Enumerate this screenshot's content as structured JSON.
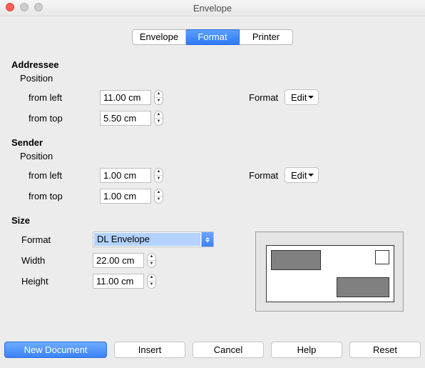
{
  "window": {
    "title": "Envelope"
  },
  "tabs": {
    "envelope": "Envelope",
    "format": "Format",
    "printer": "Printer"
  },
  "addressee": {
    "section": "Addressee",
    "position": "Position",
    "from_left_label": "from left",
    "from_left_value": "11.00 cm",
    "from_top_label": "from top",
    "from_top_value": "5.50 cm",
    "format_label": "Format",
    "format_button": "Edit"
  },
  "sender": {
    "section": "Sender",
    "position": "Position",
    "from_left_label": "from left",
    "from_left_value": "1.00 cm",
    "from_top_label": "from top",
    "from_top_value": "1.00 cm",
    "format_label": "Format",
    "format_button": "Edit"
  },
  "size": {
    "section": "Size",
    "format_label": "Format",
    "format_value": "DL Envelope",
    "width_label": "Width",
    "width_value": "22.00 cm",
    "height_label": "Height",
    "height_value": "11.00 cm"
  },
  "buttons": {
    "new_document": "New Document",
    "insert": "Insert",
    "cancel": "Cancel",
    "help": "Help",
    "reset": "Reset"
  }
}
